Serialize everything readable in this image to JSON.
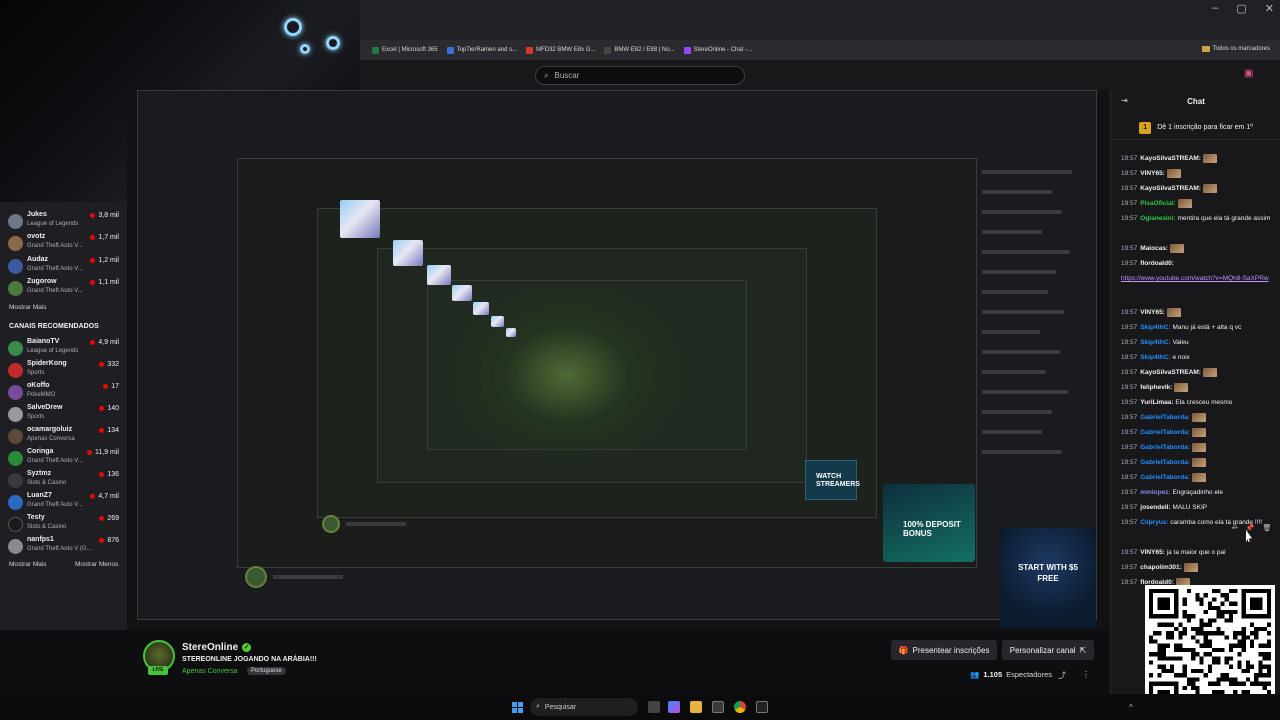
{
  "browser": {
    "window_controls": [
      "–",
      "▢",
      "✕"
    ],
    "bookmarks": [
      {
        "label": "Excel | Microsoft 365",
        "color": "#1f7a3f"
      },
      {
        "label": "TopTierRamen and s...",
        "color": "#3a6fd8"
      },
      {
        "label": "MFD32 BMW E8x G...",
        "color": "#d33a2c"
      },
      {
        "label": "BMW E82 / E88 | No...",
        "color": "#444444"
      },
      {
        "label": "StereOnline - Chat -...",
        "color": "#9146ff"
      }
    ],
    "all_bookmarks": "Todos os marcadores"
  },
  "topnav": {
    "search_placeholder": "Buscar"
  },
  "sidebar": {
    "followed": [
      {
        "name": "Jukes",
        "category": "League of Legends",
        "viewers": "3,8 mil",
        "color": "#6a7a8a"
      },
      {
        "name": "ovotz",
        "category": "Grand Theft Auto V...",
        "viewers": "1,7 mil",
        "color": "#8a6a4a"
      },
      {
        "name": "Audaz",
        "category": "Grand Theft Auto V...",
        "viewers": "1,2 mil",
        "color": "#3a5aa0"
      },
      {
        "name": "Zugorow",
        "category": "Grand Theft Auto V...",
        "viewers": "1,1 mil",
        "color": "#4a7a3a"
      }
    ],
    "show_more": "Mostrar Mais",
    "recommended_heading": "CANAIS RECOMENDADOS",
    "recommended": [
      {
        "name": "BaianoTV",
        "category": "League of Legends",
        "viewers": "4,9 mil",
        "color": "#3a8a4a"
      },
      {
        "name": "SpiderKong",
        "category": "Sports",
        "viewers": "332",
        "color": "#c02a2a"
      },
      {
        "name": "oKoffo",
        "category": "PokeMMO",
        "viewers": "17",
        "color": "#7a4a9a"
      },
      {
        "name": "SalveDrew",
        "category": "Sports",
        "viewers": "140",
        "color": "#9a9a9a"
      },
      {
        "name": "ocamargoluiz",
        "category": "Apenas Conversa",
        "viewers": "134",
        "color": "#5a4a3a"
      },
      {
        "name": "Coringa",
        "category": "Grand Theft Auto V...",
        "viewers": "11,9 mil",
        "color": "#2a8a3a"
      },
      {
        "name": "Syztmz",
        "category": "Slots & Casino",
        "viewers": "136",
        "color": "#3a3a3a"
      },
      {
        "name": "LuanZ7",
        "category": "Grand Theft Auto V...",
        "viewers": "4,7 mil",
        "color": "#2a6ac0"
      },
      {
        "name": "Testy",
        "category": "Slots & Casino",
        "viewers": "269",
        "color": "#1a1a1a"
      },
      {
        "name": "nanfps1",
        "category": "Grand Theft Auto V (G...",
        "viewers": "876",
        "color": "#8a8a8a"
      }
    ],
    "show_more_bottom": "Mostrar Mais",
    "show_less": "Mostrar Menos"
  },
  "stream": {
    "streamer": "StereOnline",
    "title": "STEREONLINE JOGANDO NA ARÁBIA!!!",
    "category": "Apenas Conversa",
    "tag": "Portuguese",
    "live": "LIVE",
    "sub_button": "Presentear inscrições",
    "customize_button": "Personalizar canal",
    "viewer_count": "1.105",
    "viewer_label": "Espectadores"
  },
  "promos": {
    "watch_streamers": "WATCH STREAMERS",
    "deposit_bonus": "100% DEPOSIT BONUS",
    "start_free": "START WITH $5 FREE"
  },
  "taskbar": {
    "search_placeholder": "Pesquisar"
  },
  "chat": {
    "title": "Chat",
    "goal_text": "Dê 1 inscrição para ficar em 1º",
    "messages": [
      {
        "ts": "19:57",
        "user": "KayoSilvaSTREAM:",
        "color": "#efeff1",
        "text": "",
        "emote": true
      },
      {
        "ts": "19:57",
        "user": "VINY65:",
        "color": "#efeff1",
        "text": "",
        "emote": true
      },
      {
        "ts": "19:57",
        "user": "KayoSilvaSTREAM:",
        "color": "#efeff1",
        "text": "",
        "emote": true
      },
      {
        "ts": "19:57",
        "user": "PisaOficial:",
        "color": "#2bc840",
        "text": "",
        "emote": true
      },
      {
        "ts": "19:57",
        "user": "Oglanesini:",
        "color": "#2bc840",
        "text": "mentira que ela tá grande assim",
        "emote": false
      },
      {
        "ts": "19:57",
        "user": "Maiocas:",
        "color": "#efeff1",
        "text": "",
        "emote": true
      },
      {
        "ts": "19:57",
        "user": "flordoald0:",
        "color": "#efeff1",
        "text": "",
        "emote": false
      },
      {
        "ts": "",
        "user": "",
        "color": "#efeff1",
        "text": "https://www.youtube.com/watch?v=MQh8-SaXPRw",
        "emote": false
      },
      {
        "ts": "19:57",
        "user": "VINY65:",
        "color": "#efeff1",
        "text": "",
        "emote": true
      },
      {
        "ts": "19:57",
        "user": "Skip4thC:",
        "color": "#1e90ff",
        "text": "Manu já está + alta q vc",
        "emote": false
      },
      {
        "ts": "19:57",
        "user": "Skip4thC:",
        "color": "#1e90ff",
        "text": "Valeu",
        "emote": false
      },
      {
        "ts": "19:57",
        "user": "Skip4thC:",
        "color": "#1e90ff",
        "text": "e noix",
        "emote": false
      },
      {
        "ts": "19:57",
        "user": "KayoSilvaSTREAM:",
        "color": "#efeff1",
        "text": "",
        "emote": true
      },
      {
        "ts": "19:57",
        "user": "feliphevik:",
        "color": "#efeff1",
        "text": "",
        "emote": true
      },
      {
        "ts": "19:57",
        "user": "YuriLimaa:",
        "color": "#efeff1",
        "text": "Ela cresceu mesmo",
        "emote": false
      },
      {
        "ts": "19:57",
        "user": "GabrielTaborda:",
        "color": "#1e90ff",
        "text": "",
        "emote": true
      },
      {
        "ts": "19:57",
        "user": "GabrielTaborda:",
        "color": "#1e90ff",
        "text": "",
        "emote": true
      },
      {
        "ts": "19:57",
        "user": "GabrielTaborda:",
        "color": "#1e90ff",
        "text": "",
        "emote": true
      },
      {
        "ts": "19:57",
        "user": "GabrielTaborda:",
        "color": "#1e90ff",
        "text": "",
        "emote": true
      },
      {
        "ts": "19:57",
        "user": "GabrielTaborda:",
        "color": "#1e90ff",
        "text": "",
        "emote": true
      },
      {
        "ts": "19:57",
        "user": "mmlopez:",
        "color": "#8a8af0",
        "text": "Engraçadinho ele",
        "emote": false
      },
      {
        "ts": "19:57",
        "user": "josendell:",
        "color": "#efeff1",
        "text": "MALU SKIP",
        "emote": false
      },
      {
        "ts": "19:57",
        "user": "Ciipryus:",
        "color": "#1e90ff",
        "text": "caramba como ela tá grande !!!!",
        "emote": false
      },
      {
        "ts": "19:57",
        "user": "VINY65:",
        "color": "#efeff1",
        "text": "ja ta maior que o pai",
        "emote": false
      },
      {
        "ts": "19:57",
        "user": "chapolim301:",
        "color": "#efeff1",
        "text": "",
        "emote": true
      },
      {
        "ts": "19:57",
        "user": "flordoald0:",
        "color": "#efeff1",
        "text": "",
        "emote": true
      }
    ]
  }
}
